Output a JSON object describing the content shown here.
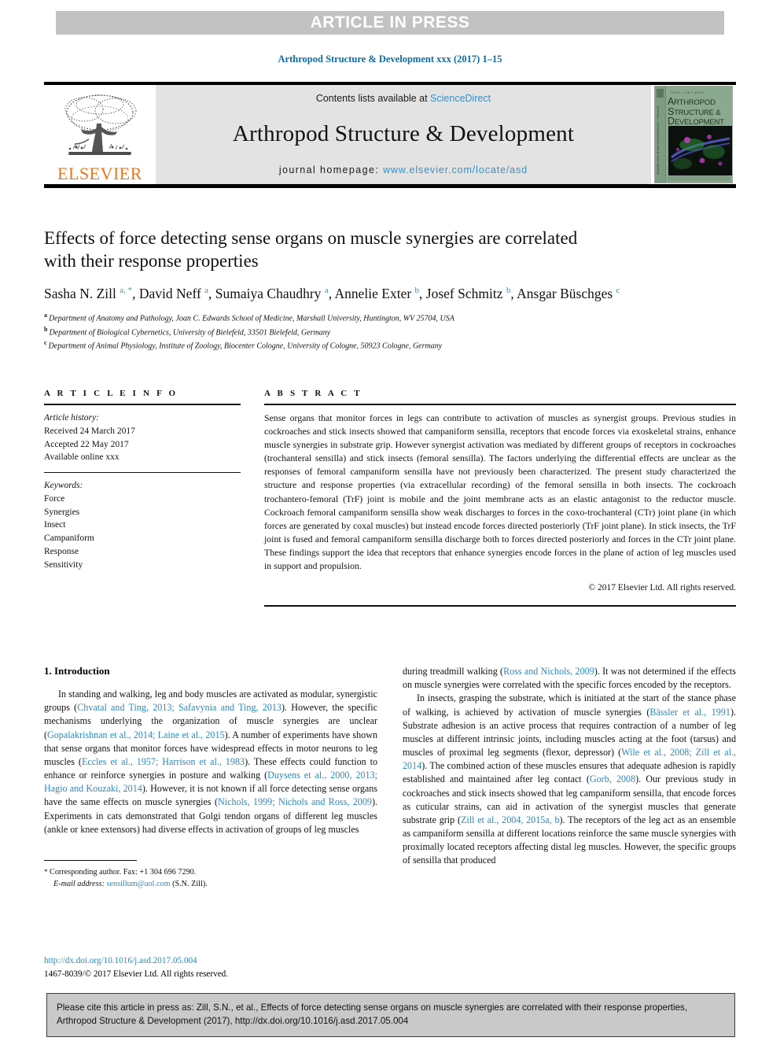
{
  "banner": {
    "text": "ARTICLE IN PRESS"
  },
  "running_head": {
    "text": "Arthropod Structure & Development xxx (2017) 1–15"
  },
  "masthead": {
    "contents_prefix": "Contents lists available at ",
    "sciencedirect": "ScienceDirect",
    "journal_title": "Arthropod Structure & Development",
    "homepage_label": "journal homepage: ",
    "homepage_url": "www.elsevier.com/locate/asd",
    "publisher": "ELSEVIER",
    "cover": {
      "eyebrow": "ISSN 1467-8039",
      "line1_cap": "A",
      "line1_rest": "RTHROPOD",
      "line2_cap": "S",
      "line2_rest": "TRUCTURE &",
      "line3_cap": "D",
      "line3_rest": "EVELOPMENT",
      "spine": "Available online at www.sciencedirect.com  ·  Volume 46"
    }
  },
  "article": {
    "title": "Effects of force detecting sense organs on muscle synergies are correlated with their response properties",
    "authors": [
      {
        "name": "Sasha N. Zill",
        "marks": "a, *"
      },
      {
        "name": "David Neff",
        "marks": "a"
      },
      {
        "name": "Sumaiya Chaudhry",
        "marks": "a"
      },
      {
        "name": "Annelie Exter",
        "marks": "b"
      },
      {
        "name": "Josef Schmitz",
        "marks": "b"
      },
      {
        "name": "Ansgar Büschges",
        "marks": "c"
      }
    ],
    "affiliations": [
      {
        "mark": "a",
        "text": "Department of Anatomy and Pathology, Joan C. Edwards School of Medicine, Marshall University, Huntington, WV 25704, USA"
      },
      {
        "mark": "b",
        "text": "Department of Biological Cybernetics, University of Bielefeld, 33501 Bielefeld, Germany"
      },
      {
        "mark": "c",
        "text": "Department of Animal Physiology, Institute of Zoology, Biocenter Cologne, University of Cologne, 50923 Cologne, Germany"
      }
    ]
  },
  "article_info": {
    "heading": "A R T I C L E  I N F O",
    "history_label": "Article history:",
    "history": [
      "Received 24 March 2017",
      "Accepted 22 May 2017",
      "Available online xxx"
    ],
    "keywords_label": "Keywords:",
    "keywords": [
      "Force",
      "Synergies",
      "Insect",
      "Campaniform",
      "Response",
      "Sensitivity"
    ]
  },
  "abstract": {
    "heading": "A B S T R A C T",
    "text": "Sense organs that monitor forces in legs can contribute to activation of muscles as synergist groups. Previous studies in cockroaches and stick insects showed that campaniform sensilla, receptors that encode forces via exoskeletal strains, enhance muscle synergies in substrate grip. However synergist activation was mediated by different groups of receptors in cockroaches (trochanteral sensilla) and stick insects (femoral sensilla). The factors underlying the differential effects are unclear as the responses of femoral campaniform sensilla have not previously been characterized. The present study characterized the structure and response properties (via extracellular recording) of the femoral sensilla in both insects. The cockroach trochantero-femoral (TrF) joint is mobile and the joint membrane acts as an elastic antagonist to the reductor muscle. Cockroach femoral campaniform sensilla show weak discharges to forces in the coxo-trochanteral (CTr) joint plane (in which forces are generated by coxal muscles) but instead encode forces directed posteriorly (TrF joint plane). In stick insects, the TrF joint is fused and femoral campaniform sensilla discharge both to forces directed posteriorly and forces in the CTr joint plane. These findings support the idea that receptors that enhance synergies encode forces in the plane of action of leg muscles used in support and propulsion.",
    "copyright": "© 2017 Elsevier Ltd. All rights reserved."
  },
  "body": {
    "section_heading": "1. Introduction",
    "left_paragraphs": [
      "In standing and walking, leg and body muscles are activated as modular, synergistic groups (Chvatal and Ting, 2013; Safavynia and Ting, 2013). However, the specific mechanisms underlying the organization of muscle synergies are unclear (Gopalakrishnan et al., 2014; Laine et al., 2015). A number of experiments have shown that sense organs that monitor forces have widespread effects in motor neurons to leg muscles (Eccles et al., 1957; Harrison et al., 1983). These effects could function to enhance or reinforce synergies in posture and walking (Duysens et al., 2000, 2013; Hagio and Kouzaki, 2014). However, it is not known if all force detecting sense organs have the same effects on muscle synergies (Nichols, 1999; Nichols and Ross, 2009). Experiments in cats demonstrated that Golgi tendon organs of different leg muscles (ankle or knee extensors) had diverse effects in activation of groups of leg muscles"
    ],
    "right_paragraphs": [
      "during treadmill walking (Ross and Nichols, 2009). It was not determined if the effects on muscle synergies were correlated with the specific forces encoded by the receptors.",
      "In insects, grasping the substrate, which is initiated at the start of the stance phase of walking, is achieved by activation of muscle synergies (Bässler et al., 1991). Substrate adhesion is an active process that requires contraction of a number of leg muscles at different intrinsic joints, including muscles acting at the foot (tarsus) and muscles of proximal leg segments (flexor, depressor) (Wile et al., 2008; Zill et al., 2014). The combined action of these muscles ensures that adequate adhesion is rapidly established and maintained after leg contact (Gorb, 2008). Our previous study in cockroaches and stick insects showed that leg campaniform sensilla, that encode forces as cuticular strains, can aid in activation of the synergist muscles that generate substrate grip (Zill et al., 2004, 2015a, b). The receptors of the leg act as an ensemble as campaniform sensilla at different locations reinforce the same muscle synergies with proximally located receptors affecting distal leg muscles. However, the specific groups of sensilla that produced"
    ]
  },
  "footnote": {
    "star": "*",
    "corresponding": "Corresponding author. Fax: +1 304 696 7290.",
    "email_label": "E-mail address:",
    "email": "sensillum@aol.com",
    "email_suffix": "(S.N. Zill)."
  },
  "doi_block": {
    "doi_url": "http://dx.doi.org/10.1016/j.asd.2017.05.004",
    "issn_line": "1467-8039/© 2017 Elsevier Ltd. All rights reserved."
  },
  "cite_box": {
    "text": "Please cite this article in press as: Zill, S.N., et al., Effects of force detecting sense organs on muscle synergies are correlated with their response properties, Arthropod Structure & Development (2017), http://dx.doi.org/10.1016/j.asd.2017.05.004"
  },
  "colors": {
    "link": "#2b8ac0",
    "banner_bg": "#c2c2c2",
    "masthead_bg": "#e3e3e3",
    "elsevier_orange": "#e87722",
    "cite_bg": "#c9c9c9"
  }
}
